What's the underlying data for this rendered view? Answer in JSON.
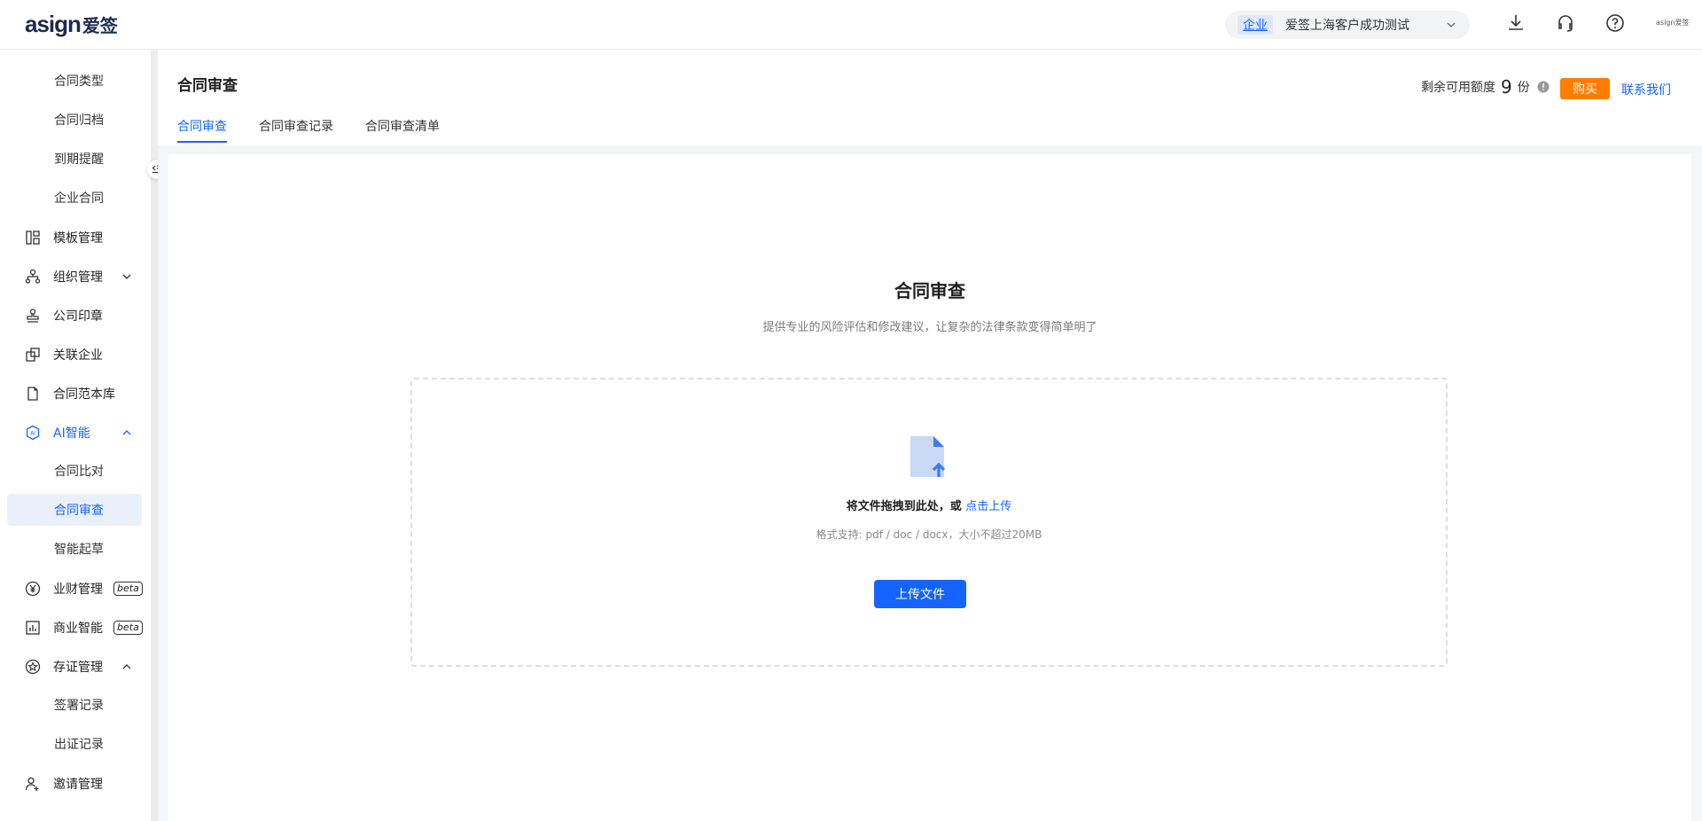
{
  "header": {
    "logo_en": "asign",
    "logo_cn": "爱签",
    "enterprise_tag": "企业",
    "enterprise_name": "爱签上海客户成功测试",
    "user_logo": "asign爱签"
  },
  "sidebar": {
    "items": [
      {
        "label": "合同类型",
        "icon": "",
        "sub": true
      },
      {
        "label": "合同归档",
        "icon": "",
        "sub": true
      },
      {
        "label": "到期提醒",
        "icon": "",
        "sub": true
      },
      {
        "label": "企业合同",
        "icon": "",
        "sub": true
      },
      {
        "label": "模板管理",
        "icon": "layout-icon"
      },
      {
        "label": "组织管理",
        "icon": "org-tree-icon",
        "chevron": "down"
      },
      {
        "label": "公司印章",
        "icon": "stamp-icon"
      },
      {
        "label": "关联企业",
        "icon": "link-boxes-icon"
      },
      {
        "label": "合同范本库",
        "icon": "document-icon"
      },
      {
        "label": "AI智能",
        "icon": "ai-icon",
        "chevron": "up",
        "highlight": true
      },
      {
        "label": "合同比对",
        "sub": true
      },
      {
        "label": "合同审查",
        "sub": true,
        "active": true
      },
      {
        "label": "智能起草",
        "sub": true
      },
      {
        "label": "业财管理",
        "icon": "yen-icon",
        "badge": "beta"
      },
      {
        "label": "商业智能",
        "icon": "bar-chart-icon",
        "badge": "beta"
      },
      {
        "label": "存证管理",
        "icon": "evidence-icon",
        "chevron": "up"
      },
      {
        "label": "签署记录",
        "sub": true
      },
      {
        "label": "出证记录",
        "sub": true
      },
      {
        "label": "邀请管理",
        "icon": "invite-icon"
      }
    ]
  },
  "page": {
    "title": "合同审查",
    "quota_label": "剩余可用额度",
    "quota_value": "9",
    "quota_unit": "份",
    "buy_label": "购买",
    "contact_label": "联系我们",
    "tabs": [
      {
        "label": "合同审查",
        "active": true
      },
      {
        "label": "合同审查记录"
      },
      {
        "label": "合同审查清单"
      }
    ]
  },
  "card": {
    "title": "合同审查",
    "subtitle": "提供专业的风险评估和修改建议，让复杂的法律条款变得简单明了",
    "drop_text": "将文件拖拽到此处，或",
    "drop_link": "点击上传",
    "hint": "格式支持: pdf / doc / docx，大小不超过20MB",
    "upload_button": "上传文件"
  },
  "colors": {
    "primary": "#1664ff",
    "buy": "#ff7d00",
    "active_bg": "#eaf0fb"
  }
}
